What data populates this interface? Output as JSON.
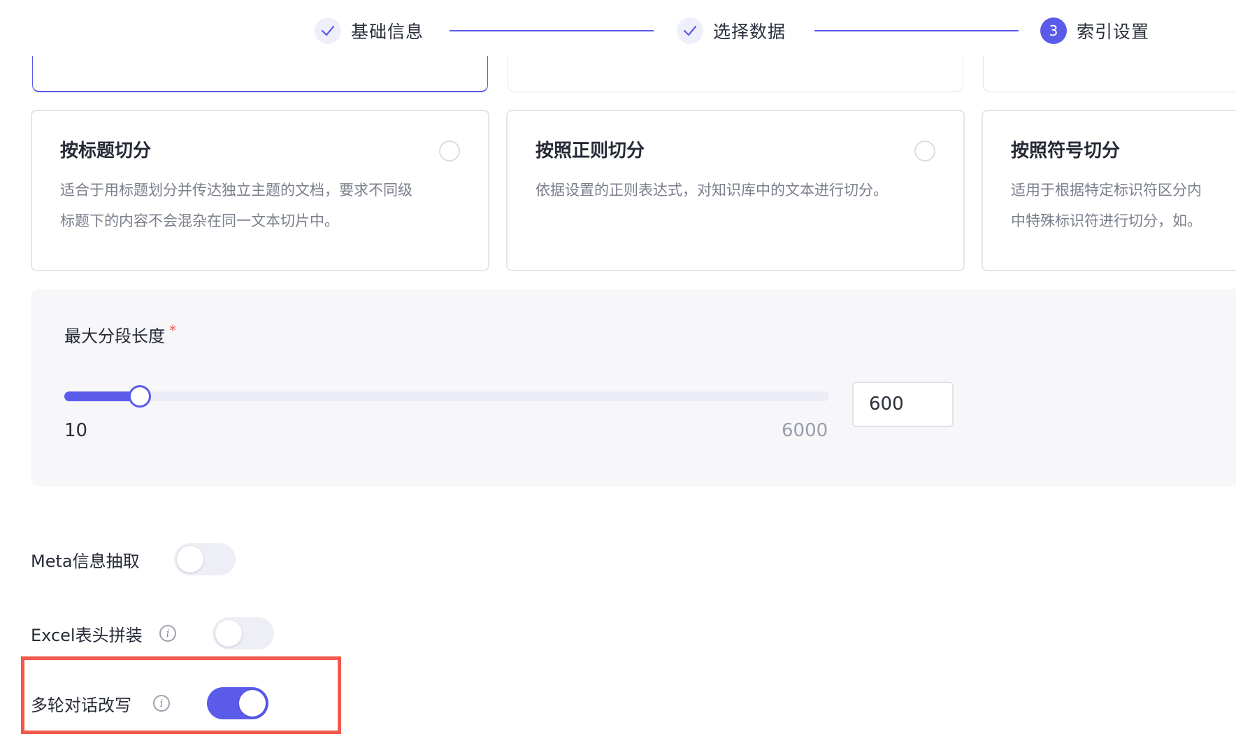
{
  "stepper": {
    "steps": [
      {
        "label": "基础信息",
        "state": "done",
        "icon": "check-icon"
      },
      {
        "label": "选择数据",
        "state": "done",
        "icon": "check-icon"
      },
      {
        "label": "索引设置",
        "state": "active",
        "number": "3"
      }
    ],
    "accent": "#5b5bea"
  },
  "cards": [
    {
      "title": "按标题切分",
      "desc_lines": [
        "适合于用标题划分并传达独立主题的文档，要求不同级",
        "标题下的内容不会混杂在同一文本切片中。"
      ]
    },
    {
      "title": "按照正则切分",
      "desc_lines": [
        "依据设置的正则表达式，对知识库中的文本进行切分。",
        ""
      ]
    },
    {
      "title": "按照符号切分",
      "desc_lines": [
        "适用于根据特定标识符区分内",
        "中特殊标识符进行切分，如。"
      ]
    }
  ],
  "max_segment": {
    "label": "最大分段长度",
    "required_mark": "*",
    "min_label": "10",
    "max_label": "6000",
    "min": 10,
    "max": 6000,
    "value": 600,
    "input_value": "600"
  },
  "options": {
    "meta": {
      "label": "Meta信息抽取",
      "enabled": false
    },
    "excel": {
      "label": "Excel表头拼装",
      "enabled": false,
      "info_icon": "info-icon"
    },
    "rewrite": {
      "label": "多轮对话改写",
      "enabled": true,
      "info_icon": "info-icon"
    }
  },
  "colors": {
    "accent": "#5b5bea",
    "highlight": "#f2594b",
    "required": "#f05a4a"
  }
}
